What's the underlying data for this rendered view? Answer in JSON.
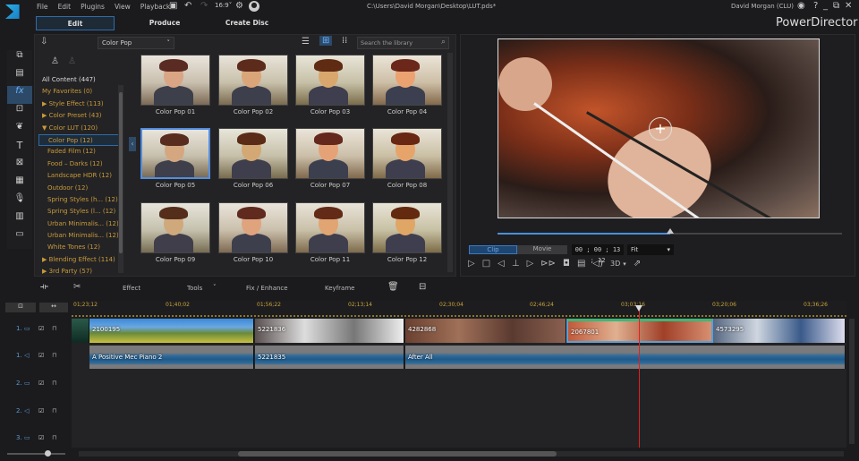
{
  "app": {
    "title": "PowerDirector",
    "file_path": "C:\\Users\\David Morgan\\Desktop\\LUT.pds*",
    "user": "David Morgan (CLU)"
  },
  "menu": [
    "File",
    "Edit",
    "Plugins",
    "View",
    "Playback"
  ],
  "tabs": [
    {
      "label": "Edit",
      "active": true
    },
    {
      "label": "Produce"
    },
    {
      "label": "Create Disc"
    }
  ],
  "library": {
    "category": "Color Pop",
    "search_placeholder": "Search the library",
    "tree": [
      {
        "label": "All Content  (447)",
        "color": "#dddddd"
      },
      {
        "label": "My Favorites  (0)"
      },
      {
        "label": "▶ Style Effect  (113)"
      },
      {
        "label": "▶ Color Preset  (43)"
      },
      {
        "label": "▼ Color LUT  (120)"
      },
      {
        "label": "Color Pop  (12)",
        "indent": true,
        "selected": true
      },
      {
        "label": "Faded Film  (12)",
        "indent": true
      },
      {
        "label": "Food – Darks  (12)",
        "indent": true
      },
      {
        "label": "Landscape HDR  (12)",
        "indent": true
      },
      {
        "label": "Outdoor  (12)",
        "indent": true
      },
      {
        "label": "Spring Styles (h...  (12)",
        "indent": true
      },
      {
        "label": "Spring Styles (l...  (12)",
        "indent": true
      },
      {
        "label": "Urban Minimalis...  (12)",
        "indent": true
      },
      {
        "label": "Urban Minimalis...  (12)",
        "indent": true
      },
      {
        "label": "White Tones  (12)",
        "indent": true
      },
      {
        "label": "▶ Blending Effect  (114)"
      },
      {
        "label": "▶ 3rd Party  (57)"
      }
    ],
    "items": [
      "Color Pop 01",
      "Color Pop 02",
      "Color Pop 03",
      "Color Pop 04",
      "Color Pop 05",
      "Color Pop 06",
      "Color Pop 07",
      "Color Pop 08",
      "Color Pop 09",
      "Color Pop 10",
      "Color Pop 11",
      "Color Pop 12"
    ],
    "selected_item": "Color Pop 05"
  },
  "preview": {
    "mode_clip": "Clip",
    "mode_movie": "Movie",
    "timecode": "00 ; 00 ; 13 ; 12",
    "zoom": "Fit",
    "mode_3d": "3D",
    "progress": 0.5
  },
  "timeline_toolbar": {
    "effect": "Effect",
    "tools": "Tools",
    "fix": "Fix / Enhance",
    "keyframe": "Keyframe"
  },
  "ruler": [
    "01;23;12",
    "01;40;02",
    "01;56;22",
    "02;13;14",
    "02;30;04",
    "02;46;24",
    "03;03;16",
    "03;20;06",
    "03;36;26"
  ],
  "tracks": [
    {
      "label": "1.",
      "type": "video"
    },
    {
      "label": "1.",
      "type": "audio"
    },
    {
      "label": "2.",
      "type": "video"
    },
    {
      "label": "2.",
      "type": "audio"
    },
    {
      "label": "3.",
      "type": "video"
    }
  ],
  "video_clips": [
    {
      "label": ""
    },
    {
      "label": "2100195"
    },
    {
      "label": "5221836"
    },
    {
      "label": "4282868"
    },
    {
      "label": "2067801"
    },
    {
      "label": "4573295"
    }
  ],
  "audio_clips": [
    {
      "label": "A Positive Mec Piano 2"
    },
    {
      "label": "5221835"
    },
    {
      "label": "After All"
    }
  ]
}
